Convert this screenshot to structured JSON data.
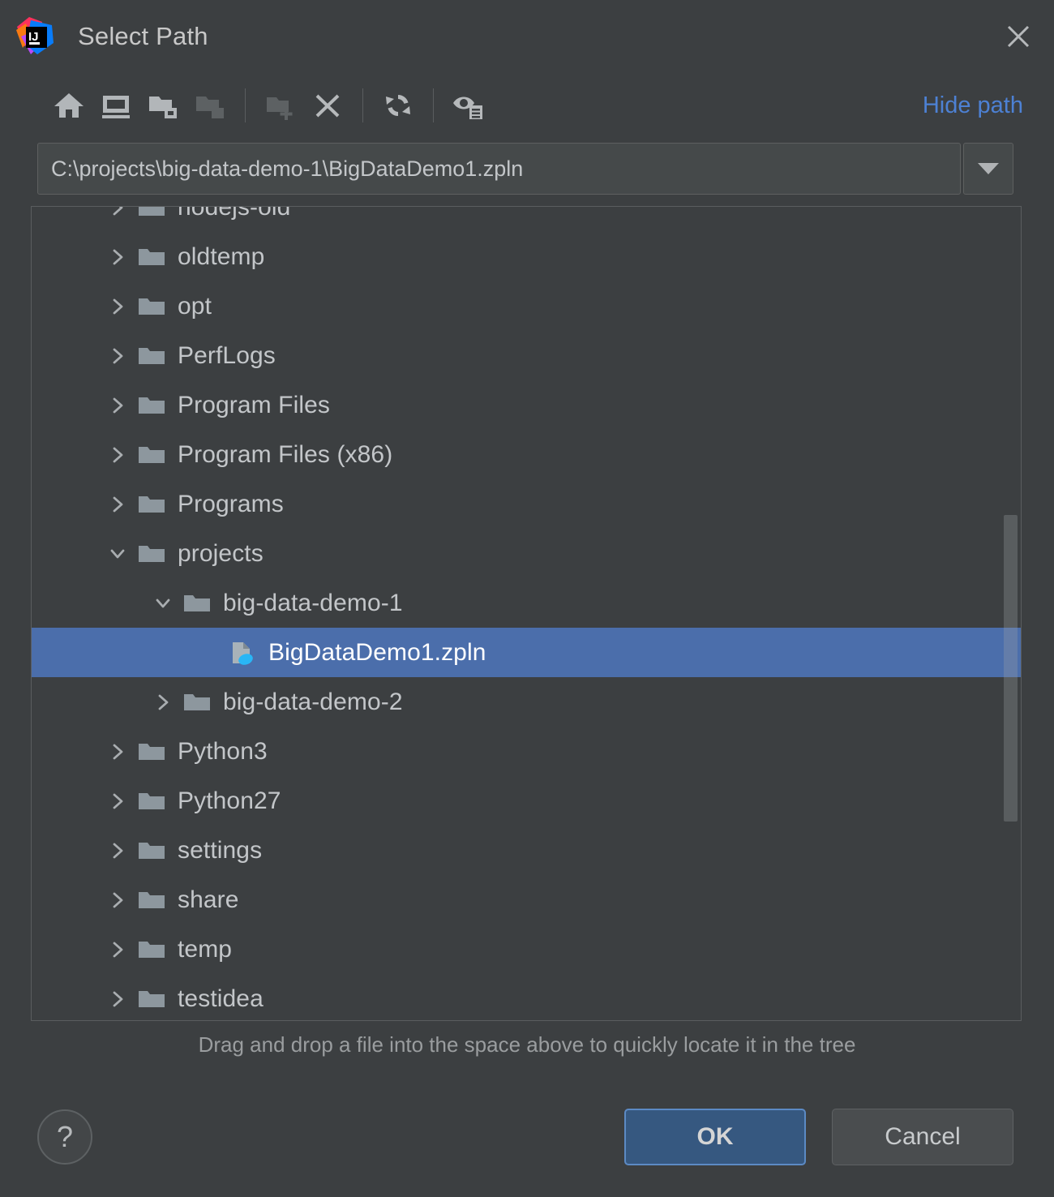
{
  "window": {
    "title": "Select Path",
    "logo_text_top": "IJ",
    "close_icon": "close-icon"
  },
  "toolbar": {
    "buttons": [
      {
        "name": "home-icon",
        "tooltip": "Home",
        "enabled": true
      },
      {
        "name": "desktop-icon",
        "tooltip": "Desktop",
        "enabled": true
      },
      {
        "name": "project-folder-icon",
        "tooltip": "Project Directory",
        "enabled": true
      },
      {
        "name": "module-folder-icon",
        "tooltip": "Module Directory",
        "enabled": false
      },
      {
        "name": "new-folder-icon",
        "tooltip": "New Folder",
        "enabled": false
      },
      {
        "name": "delete-icon",
        "tooltip": "Delete",
        "enabled": true
      },
      {
        "name": "refresh-icon",
        "tooltip": "Refresh",
        "enabled": true
      },
      {
        "name": "show-hidden-files-icon",
        "tooltip": "Show Hidden Files",
        "enabled": true
      }
    ],
    "hide_path_label": "Hide path",
    "hide_path_color": "#4d81d4"
  },
  "path_combo": {
    "value": "C:\\projects\\big-data-demo-1\\BigDataDemo1.zpln",
    "placeholder": "",
    "dropdown_icon": "chevron-down-icon"
  },
  "tree": {
    "rows": [
      {
        "label": "nodejs-old",
        "indent": 0,
        "state": "collapsed",
        "icon": "folder-icon",
        "selected": false,
        "clipped": true
      },
      {
        "label": "oldtemp",
        "indent": 0,
        "state": "collapsed",
        "icon": "folder-icon",
        "selected": false
      },
      {
        "label": "opt",
        "indent": 0,
        "state": "collapsed",
        "icon": "folder-icon",
        "selected": false
      },
      {
        "label": "PerfLogs",
        "indent": 0,
        "state": "collapsed",
        "icon": "folder-icon",
        "selected": false
      },
      {
        "label": "Program Files",
        "indent": 0,
        "state": "collapsed",
        "icon": "folder-icon",
        "selected": false
      },
      {
        "label": "Program Files (x86)",
        "indent": 0,
        "state": "collapsed",
        "icon": "folder-icon",
        "selected": false
      },
      {
        "label": "Programs",
        "indent": 0,
        "state": "collapsed",
        "icon": "folder-icon",
        "selected": false
      },
      {
        "label": "projects",
        "indent": 0,
        "state": "expanded",
        "icon": "folder-icon",
        "selected": false
      },
      {
        "label": "big-data-demo-1",
        "indent": 1,
        "state": "expanded",
        "icon": "folder-icon",
        "selected": false
      },
      {
        "label": "BigDataDemo1.zpln",
        "indent": 2,
        "state": "leaf",
        "icon": "zeppelin-file-icon",
        "selected": true
      },
      {
        "label": "big-data-demo-2",
        "indent": 1,
        "state": "collapsed",
        "icon": "folder-icon",
        "selected": false
      },
      {
        "label": "Python3",
        "indent": 0,
        "state": "collapsed",
        "icon": "folder-icon",
        "selected": false
      },
      {
        "label": "Python27",
        "indent": 0,
        "state": "collapsed",
        "icon": "folder-icon",
        "selected": false
      },
      {
        "label": "settings",
        "indent": 0,
        "state": "collapsed",
        "icon": "folder-icon",
        "selected": false
      },
      {
        "label": "share",
        "indent": 0,
        "state": "collapsed",
        "icon": "folder-icon",
        "selected": false
      },
      {
        "label": "temp",
        "indent": 0,
        "state": "collapsed",
        "icon": "folder-icon",
        "selected": false
      },
      {
        "label": "testidea",
        "indent": 0,
        "state": "collapsed",
        "icon": "folder-icon",
        "selected": false,
        "clipped": true
      }
    ],
    "selection_color": "#4b6eab",
    "folder_color": "#8d979e"
  },
  "hint": {
    "text": "Drag and drop a file into the space above to quickly locate it in the tree"
  },
  "footer": {
    "help_label": "?",
    "ok_label": "OK",
    "cancel_label": "Cancel",
    "ok_color": "#365880"
  }
}
